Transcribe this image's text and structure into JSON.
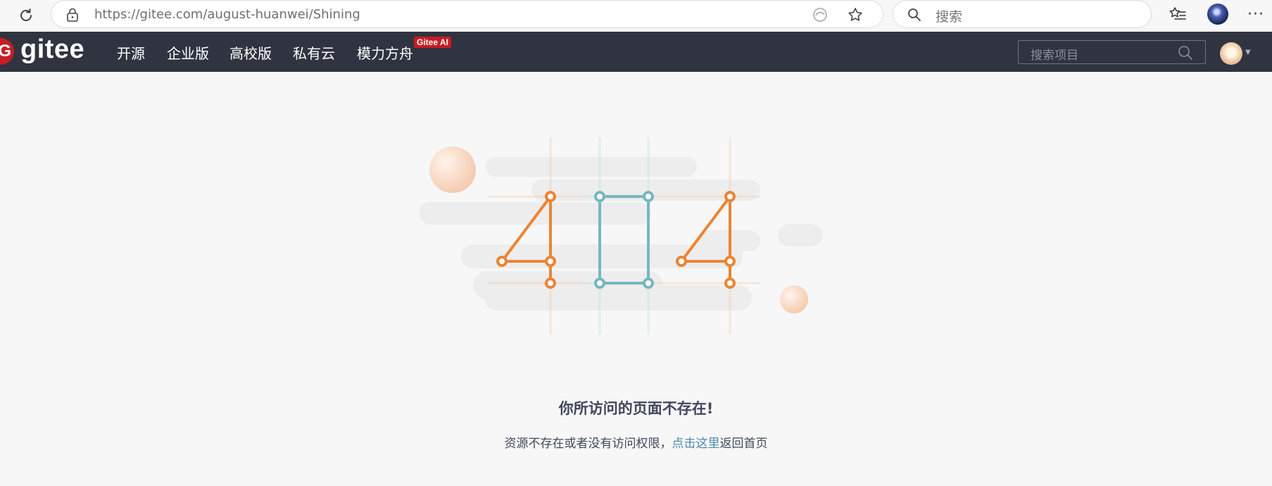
{
  "browser": {
    "url_host": "https://gitee.com",
    "url_path": "/august-huanwei/Shining",
    "search_placeholder": "搜索"
  },
  "header": {
    "logo_text": "gitee",
    "logo_letter": "G",
    "nav": [
      "开源",
      "企业版",
      "高校版",
      "私有云",
      "模力方舟"
    ],
    "ai_badge": "Gitee AI",
    "search_placeholder": "搜索项目"
  },
  "error": {
    "code_illustration": "404",
    "title": "你所访问的页面不存在!",
    "desc_before": "资源不存在或者没有访问权限，",
    "link_text": "点击这里",
    "desc_after": "返回首页"
  },
  "colors": {
    "header_bg": "#2f3440",
    "brand_red": "#c71d23",
    "digit_orange": "#ec8433",
    "digit_teal": "#78b7bf",
    "link": "#4e8aab"
  }
}
